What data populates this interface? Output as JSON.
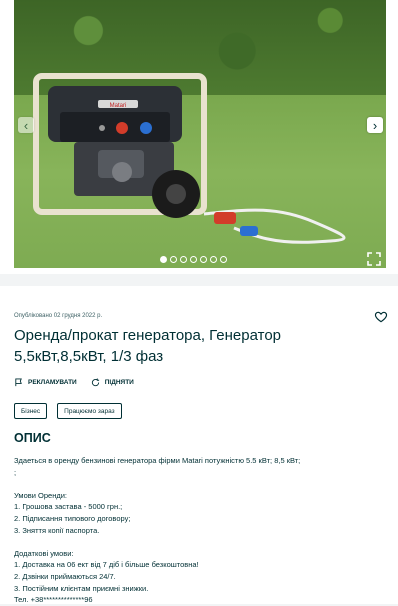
{
  "gallery": {
    "photo_alt": "generator on grass",
    "generator_brand": "Matari",
    "dots_total": 7,
    "active_dot": 0
  },
  "ad": {
    "published": "Опубліковано 02 грудня 2022 р.",
    "title": "Оренда/прокат генератора, Генератор 5,5кВт,8,5кВт, 1/3 фаз",
    "actions": {
      "promote": "РЕКЛАМУВАТИ",
      "raise": "ПІДНЯТИ"
    },
    "tags": [
      "Бізнес",
      "Працюємо зараз"
    ]
  },
  "description": {
    "heading": "ОПИС",
    "lines": [
      "Здаеться в оренду бензинові генератора фірми Matari потужністю 5.5 кВт; 8,5 кВт;",
      ";",
      "",
      "Умови Оренди:",
      "1. Грошова застава - 5000 грн.;",
      "2. Підписання типового договору;",
      "3. Зняття копії паспорта.",
      "",
      "Додаткові умови:",
      "1. Доставка на 06 ект від 7 діб і більше безкоштовна!",
      "2. Дзвінки приймаються 24/7.",
      "3. Постійним клієнтам приємні знижки.",
      "Тел. +38**************96"
    ]
  },
  "colors": {
    "text": "#002f34",
    "background": "#f2f4f5",
    "card": "#ffffff"
  }
}
